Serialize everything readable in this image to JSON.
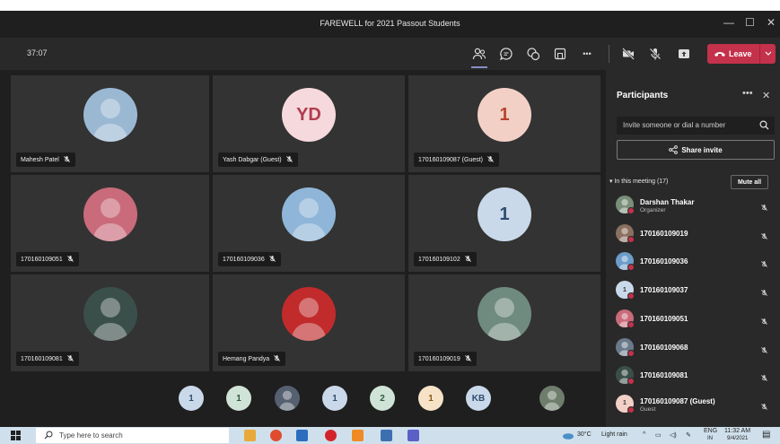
{
  "window": {
    "title": "FAREWELL for 2021 Passout Students",
    "minimize": "—",
    "maximize": "☐",
    "close": "✕"
  },
  "toolbar": {
    "timer": "37:07",
    "more": "•••",
    "leave_label": "Leave"
  },
  "tiles": [
    {
      "name": "Mahesh Patel",
      "avatar_text": "",
      "avatar_bg": "#9bb8d3"
    },
    {
      "name": "Yash Dabgar (Guest)",
      "avatar_text": "YD",
      "avatar_bg": "#f6d9dc",
      "avatar_fg": "#b23c4d"
    },
    {
      "name": "170160109087 (Guest)",
      "avatar_text": "1",
      "avatar_bg": "#f2d0c6",
      "avatar_fg": "#b5462d"
    },
    {
      "name": "170160109051",
      "avatar_text": "",
      "avatar_bg": "#c96b7a"
    },
    {
      "name": "170160109036",
      "avatar_text": "",
      "avatar_bg": "#8fb6d8"
    },
    {
      "name": "170160109102",
      "avatar_text": "1",
      "avatar_bg": "#c9d9ea",
      "avatar_fg": "#2f4d6e"
    },
    {
      "name": "170160109081",
      "avatar_text": "",
      "avatar_bg": "#3b4f4a"
    },
    {
      "name": "Hemang Pandya",
      "avatar_text": "",
      "avatar_bg": "#c12b2b"
    },
    {
      "name": "170160109019",
      "avatar_text": "",
      "avatar_bg": "#6f8a7f"
    }
  ],
  "strip": [
    {
      "text": "1",
      "bg": "#c9d9ea",
      "fg": "#2f4d6e"
    },
    {
      "text": "1",
      "bg": "#cfe3d6",
      "fg": "#2c5a3d"
    },
    {
      "text": "",
      "bg": "#556070",
      "fg": "#fff"
    },
    {
      "text": "1",
      "bg": "#c9d9ea",
      "fg": "#2f4d6e"
    },
    {
      "text": "2",
      "bg": "#cfe3d6",
      "fg": "#2c5a3d"
    },
    {
      "text": "1",
      "bg": "#f6e2c6",
      "fg": "#8a5a1a"
    },
    {
      "text": "KB",
      "bg": "#c9d9ea",
      "fg": "#2f4d6e"
    },
    {
      "text": "",
      "bg": "#6f7d6c",
      "fg": "#fff"
    }
  ],
  "panel": {
    "title": "Participants",
    "more": "•••",
    "close": "✕",
    "invite_placeholder": "Invite someone or dial a number",
    "share_label": "Share invite",
    "in_meeting": "In this meeting (17)",
    "mute_all": "Mute all",
    "participants": [
      {
        "name": "Darshan Thakar",
        "role": "Organizer",
        "avatar_text": "",
        "avatar_bg": "#7a8f7a"
      },
      {
        "name": "170160109019",
        "role": "",
        "avatar_text": "",
        "avatar_bg": "#8a7060"
      },
      {
        "name": "170160109036",
        "role": "",
        "avatar_text": "",
        "avatar_bg": "#6c9cc8"
      },
      {
        "name": "170160109037",
        "role": "",
        "avatar_text": "1",
        "avatar_bg": "#c9d9ea"
      },
      {
        "name": "170160109051",
        "role": "",
        "avatar_text": "",
        "avatar_bg": "#c96b7a"
      },
      {
        "name": "170160109068",
        "role": "",
        "avatar_text": "",
        "avatar_bg": "#6b7a8a"
      },
      {
        "name": "170160109081",
        "role": "",
        "avatar_text": "",
        "avatar_bg": "#3b4f4a"
      },
      {
        "name": "170160109087 (Guest)",
        "role": "Guest",
        "avatar_text": "1",
        "avatar_bg": "#f2d0c6"
      }
    ]
  },
  "taskbar": {
    "search_placeholder": "Type here to search",
    "weather": "30°C",
    "weather_text": "Light rain",
    "lang_1": "ENG",
    "lang_2": "IN",
    "time": "11:32 AM",
    "date": "9/4/2021"
  }
}
